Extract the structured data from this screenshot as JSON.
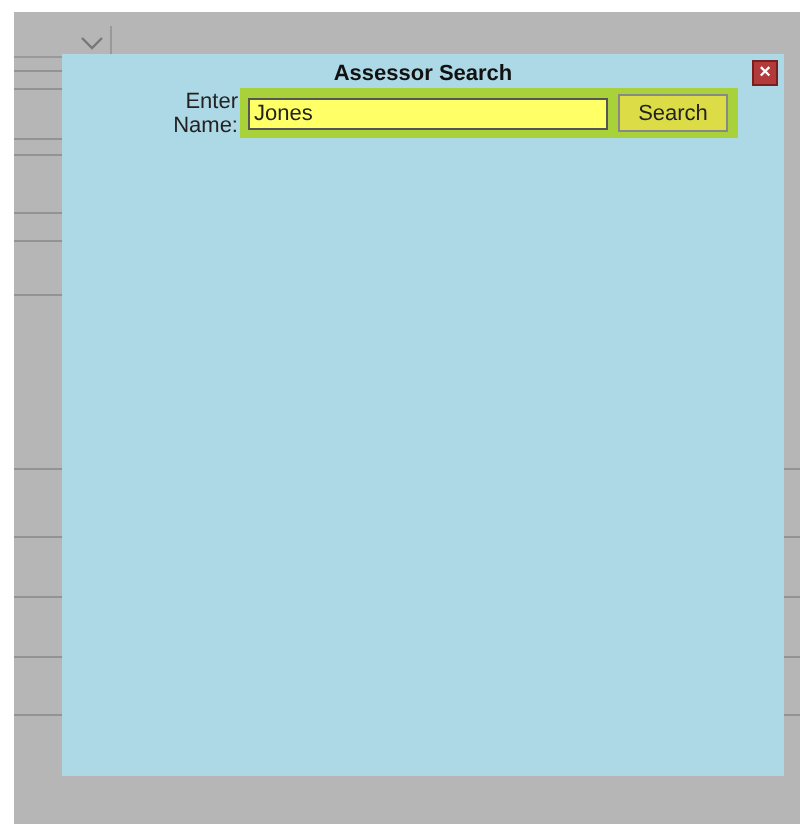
{
  "dialog": {
    "title": "Assessor Search",
    "close": "×",
    "field_label": "Enter Name:",
    "name_field": {
      "value": "Jones"
    },
    "search_button": "Search"
  }
}
